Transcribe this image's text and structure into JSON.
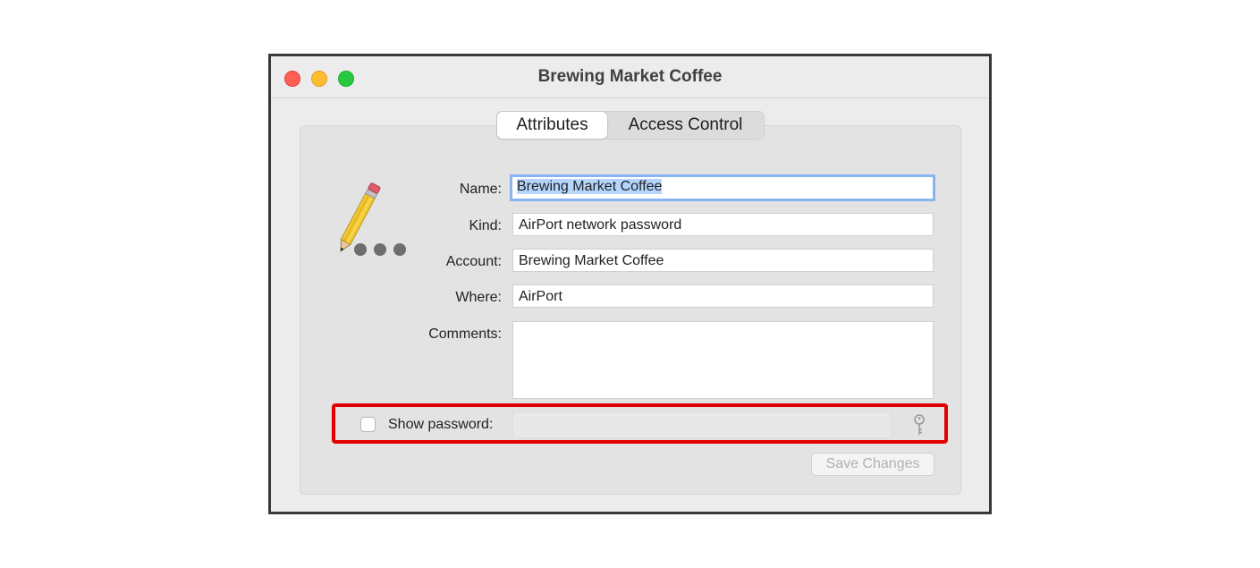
{
  "window": {
    "title": "Brewing Market Coffee"
  },
  "tabs": [
    {
      "label": "Attributes",
      "selected": true
    },
    {
      "label": "Access Control",
      "selected": false
    }
  ],
  "form": {
    "name_label": "Name:",
    "name_value": "Brewing Market Coffee",
    "kind_label": "Kind:",
    "kind_value": "AirPort network password",
    "account_label": "Account:",
    "account_value": "Brewing Market Coffee",
    "where_label": "Where:",
    "where_value": "AirPort",
    "comments_label": "Comments:",
    "comments_value": "",
    "show_password_label": "Show password:",
    "show_password_checked": false,
    "password_value": ""
  },
  "buttons": {
    "save_label": "Save Changes"
  },
  "icons": {
    "app_icon": "pencil-dots-icon",
    "key_icon": "key-icon"
  },
  "colors": {
    "highlight": "#e00000",
    "focus_ring": "#8ab4f0",
    "close": "#ff5f57",
    "minimize": "#febc2e",
    "maximize": "#28c840"
  }
}
